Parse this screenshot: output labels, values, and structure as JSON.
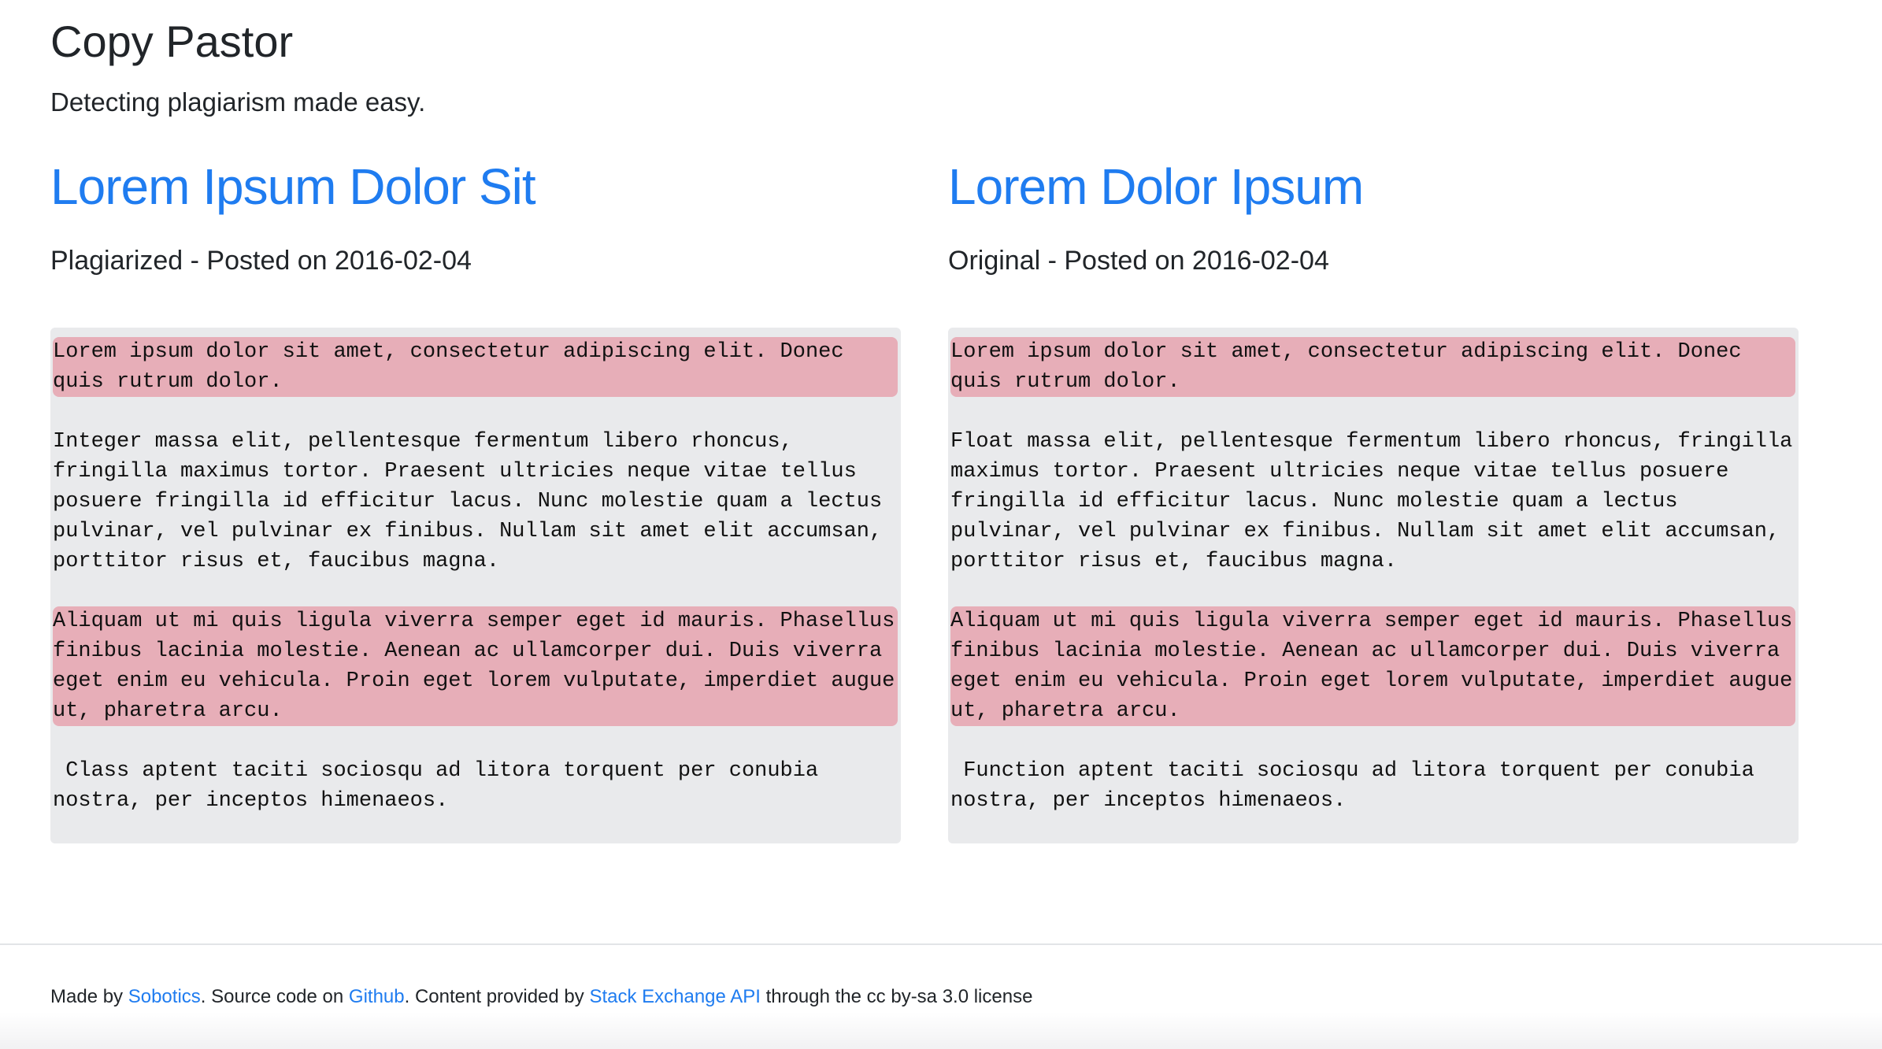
{
  "header": {
    "title": "Copy Pastor",
    "tagline": "Detecting plagiarism made easy."
  },
  "posts": [
    {
      "title": "Lorem Ipsum Dolor Sit",
      "meta": "Plagiarized - Posted on 2016-02-04",
      "paragraphs": [
        {
          "text": "Lorem ipsum dolor sit amet, consectetur adipiscing elit. Donec quis rutrum dolor.",
          "highlighted": true
        },
        {
          "text": "Integer massa elit, pellentesque fermentum libero rhoncus, fringilla maximus tortor. Praesent ultricies neque vitae tellus posuere fringilla id efficitur lacus. Nunc molestie quam a lectus pulvinar, vel pulvinar ex finibus. Nullam sit amet elit accumsan, porttitor risus et, faucibus magna.",
          "highlighted": false
        },
        {
          "text": "Aliquam ut mi quis ligula viverra semper eget id mauris. Phasellus finibus lacinia molestie. Aenean ac ullamcorper dui. Duis viverra eget enim eu vehicula. Proin eget lorem vulputate, imperdiet augue ut, pharetra arcu.",
          "highlighted": true
        },
        {
          "text": " Class aptent taciti sociosqu ad litora torquent per conubia nostra, per inceptos himenaeos.",
          "highlighted": false
        }
      ]
    },
    {
      "title": "Lorem Dolor Ipsum",
      "meta": "Original - Posted on 2016-02-04",
      "paragraphs": [
        {
          "text": "Lorem ipsum dolor sit amet, consectetur adipiscing elit. Donec quis rutrum dolor.",
          "highlighted": true
        },
        {
          "text": "Float massa elit, pellentesque fermentum libero rhoncus, fringilla maximus tortor. Praesent ultricies neque vitae tellus posuere fringilla id efficitur lacus. Nunc molestie quam a lectus pulvinar, vel pulvinar ex finibus. Nullam sit amet elit accumsan, porttitor risus et, faucibus magna.",
          "highlighted": false
        },
        {
          "text": "Aliquam ut mi quis ligula viverra semper eget id mauris. Phasellus finibus lacinia molestie. Aenean ac ullamcorper dui. Duis viverra eget enim eu vehicula. Proin eget lorem vulputate, imperdiet augue ut, pharetra arcu.",
          "highlighted": true
        },
        {
          "text": " Function aptent taciti sociosqu ad litora torquent per conubia nostra, per inceptos himenaeos.",
          "highlighted": false
        }
      ]
    }
  ],
  "footer": {
    "text_1": "Made by ",
    "link_sobotics": "Sobotics",
    "text_2": ". Source code on ",
    "link_github": "Github",
    "text_3": ". Content provided by ",
    "link_api": "Stack Exchange API",
    "text_4": " through the cc by-sa 3.0 license"
  },
  "colors": {
    "link": "#1f7cf0",
    "highlight": "#e7aeb8",
    "code_background": "#e9eaec",
    "text": "#212529"
  }
}
